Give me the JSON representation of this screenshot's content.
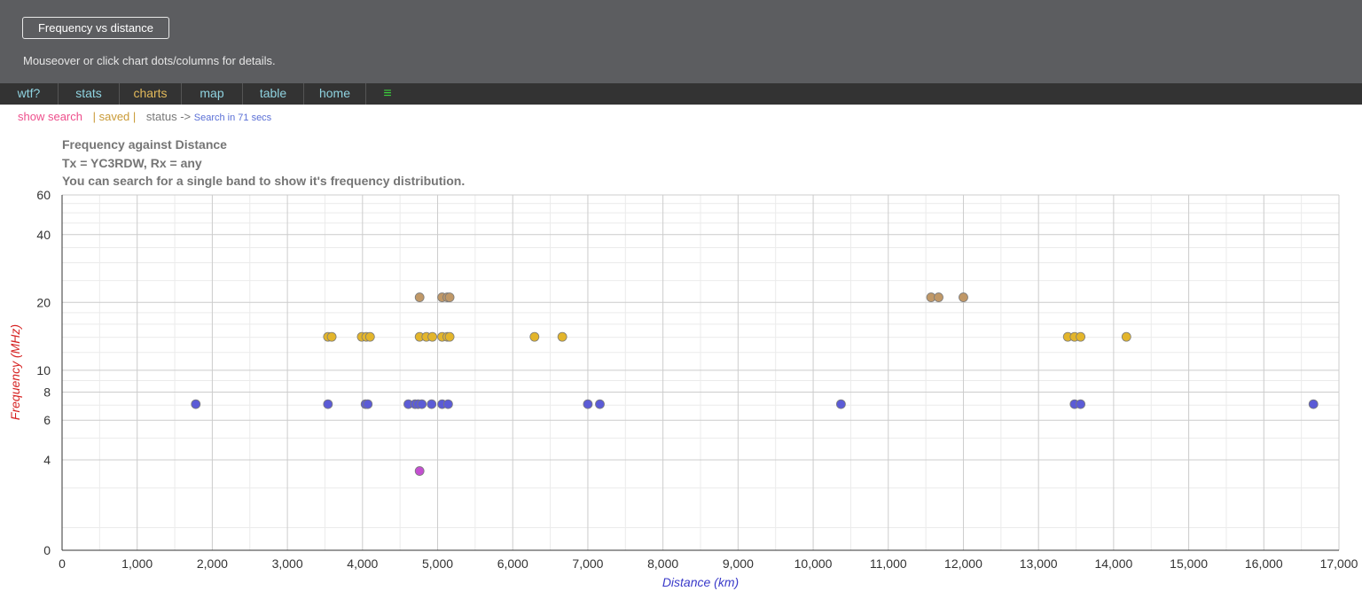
{
  "header": {
    "title_button": "Frequency vs distance",
    "hint": "Mouseover or click chart dots/columns for details."
  },
  "nav": {
    "items": [
      {
        "label": "wtf?"
      },
      {
        "label": "stats"
      },
      {
        "label": "charts",
        "active": true
      },
      {
        "label": "map"
      },
      {
        "label": "table"
      },
      {
        "label": "home"
      }
    ],
    "menu_icon": "hamburger-menu-icon",
    "menu_glyph": "≡"
  },
  "statusbar": {
    "show_search": "show search",
    "saved": "| saved |",
    "status": "status ->",
    "search_in": "Search in 71 secs"
  },
  "colors": {
    "band_40m": "#5b5bd6",
    "band_20m": "#e3b52b",
    "band_15m": "#c09867",
    "band_80m": "#c34fd0",
    "y_title": "#d62222",
    "x_title": "#3a3ac9"
  },
  "chart_data": {
    "type": "scatter",
    "title": "Frequency against Distance",
    "subtitle": "Tx = YC3RDW, Rx = any",
    "note": "You can search for a single band to show it's frequency distribution.",
    "xlabel": "Distance (km)",
    "ylabel": "Frequency (MHz)",
    "xlim": [
      0,
      17000
    ],
    "xticks": [
      0,
      1000,
      2000,
      3000,
      4000,
      5000,
      6000,
      7000,
      8000,
      9000,
      10000,
      11000,
      12000,
      13000,
      14000,
      15000,
      16000,
      17000
    ],
    "xtick_labels": [
      "0",
      "1,000",
      "2,000",
      "3,000",
      "4,000",
      "5,000",
      "6,000",
      "7,000",
      "8,000",
      "9,000",
      "10,000",
      "11,000",
      "12,000",
      "13,000",
      "14,000",
      "15,000",
      "16,000",
      "17,000"
    ],
    "y_scale": "log",
    "yticks": [
      0,
      4,
      6,
      8,
      10,
      20,
      40,
      60
    ],
    "ytick_labels": [
      "0",
      "4",
      "6",
      "8",
      "10",
      "20",
      "40",
      "60"
    ],
    "grid": true,
    "points": [
      {
        "x": 1780,
        "y": 7.07,
        "band": "band_40m"
      },
      {
        "x": 3540,
        "y": 7.07,
        "band": "band_40m"
      },
      {
        "x": 4040,
        "y": 7.07,
        "band": "band_40m"
      },
      {
        "x": 4070,
        "y": 7.07,
        "band": "band_40m"
      },
      {
        "x": 4610,
        "y": 7.07,
        "band": "band_40m"
      },
      {
        "x": 4700,
        "y": 7.07,
        "band": "band_40m"
      },
      {
        "x": 4740,
        "y": 7.07,
        "band": "band_40m"
      },
      {
        "x": 4790,
        "y": 7.07,
        "band": "band_40m"
      },
      {
        "x": 4920,
        "y": 7.07,
        "band": "band_40m"
      },
      {
        "x": 5060,
        "y": 7.07,
        "band": "band_40m"
      },
      {
        "x": 5140,
        "y": 7.07,
        "band": "band_40m"
      },
      {
        "x": 7000,
        "y": 7.07,
        "band": "band_40m"
      },
      {
        "x": 7160,
        "y": 7.07,
        "band": "band_40m"
      },
      {
        "x": 10370,
        "y": 7.07,
        "band": "band_40m"
      },
      {
        "x": 13480,
        "y": 7.07,
        "band": "band_40m"
      },
      {
        "x": 13560,
        "y": 7.07,
        "band": "band_40m"
      },
      {
        "x": 16660,
        "y": 7.07,
        "band": "band_40m"
      },
      {
        "x": 3540,
        "y": 14.07,
        "band": "band_20m"
      },
      {
        "x": 3590,
        "y": 14.07,
        "band": "band_20m"
      },
      {
        "x": 3990,
        "y": 14.07,
        "band": "band_20m"
      },
      {
        "x": 4050,
        "y": 14.07,
        "band": "band_20m"
      },
      {
        "x": 4100,
        "y": 14.07,
        "band": "band_20m"
      },
      {
        "x": 4760,
        "y": 14.07,
        "band": "band_20m"
      },
      {
        "x": 4850,
        "y": 14.07,
        "band": "band_20m"
      },
      {
        "x": 4930,
        "y": 14.07,
        "band": "band_20m"
      },
      {
        "x": 5060,
        "y": 14.07,
        "band": "band_20m"
      },
      {
        "x": 5130,
        "y": 14.07,
        "band": "band_20m"
      },
      {
        "x": 5160,
        "y": 14.07,
        "band": "band_20m"
      },
      {
        "x": 6290,
        "y": 14.07,
        "band": "band_20m"
      },
      {
        "x": 6660,
        "y": 14.07,
        "band": "band_20m"
      },
      {
        "x": 13390,
        "y": 14.07,
        "band": "band_20m"
      },
      {
        "x": 13480,
        "y": 14.07,
        "band": "band_20m"
      },
      {
        "x": 13560,
        "y": 14.07,
        "band": "band_20m"
      },
      {
        "x": 14170,
        "y": 14.07,
        "band": "band_20m"
      },
      {
        "x": 4760,
        "y": 21.07,
        "band": "band_15m"
      },
      {
        "x": 5060,
        "y": 21.07,
        "band": "band_15m"
      },
      {
        "x": 5130,
        "y": 21.07,
        "band": "band_15m"
      },
      {
        "x": 5160,
        "y": 21.07,
        "band": "band_15m"
      },
      {
        "x": 11570,
        "y": 21.07,
        "band": "band_15m"
      },
      {
        "x": 11670,
        "y": 21.07,
        "band": "band_15m"
      },
      {
        "x": 12000,
        "y": 21.07,
        "band": "band_15m"
      },
      {
        "x": 4760,
        "y": 3.57,
        "band": "band_80m"
      }
    ]
  }
}
